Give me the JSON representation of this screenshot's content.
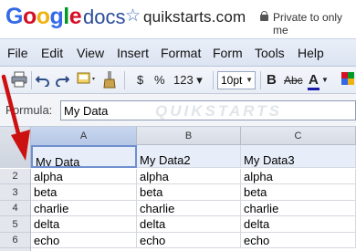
{
  "header": {
    "logo_letters": [
      {
        "ch": "G",
        "color": "#3369e8"
      },
      {
        "ch": "o",
        "color": "#d50f25"
      },
      {
        "ch": "o",
        "color": "#eeb211"
      },
      {
        "ch": "g",
        "color": "#3369e8"
      },
      {
        "ch": "l",
        "color": "#009925"
      },
      {
        "ch": "e",
        "color": "#d50f25"
      }
    ],
    "product": "docs",
    "star_icon": "star-icon",
    "doc_title": "quikstarts.com",
    "privacy": "Private to only me"
  },
  "menu": {
    "file": "File",
    "edit": "Edit",
    "view": "View",
    "insert": "Insert",
    "format": "Format",
    "form": "Form",
    "tools": "Tools",
    "help": "Help"
  },
  "toolbar": {
    "currency": "$",
    "percent": "%",
    "number_format": "123 ▾",
    "font_size": "10pt",
    "bold": "B",
    "strike": "Abc",
    "text_color": "A",
    "text_color_bar": "#1a1aa8"
  },
  "formula": {
    "label": "Formula:",
    "value": "My Data"
  },
  "watermark": "QUIKSTARTS",
  "grid": {
    "columns": [
      "A",
      "B",
      "C"
    ],
    "header_row": [
      "My Data",
      "My Data2",
      "My Data3"
    ],
    "rows": [
      {
        "num": "2",
        "cells": [
          "alpha",
          "alpha",
          "alpha"
        ]
      },
      {
        "num": "3",
        "cells": [
          "beta",
          "beta",
          "beta"
        ]
      },
      {
        "num": "4",
        "cells": [
          "charlie",
          "charlie",
          "charlie"
        ]
      },
      {
        "num": "5",
        "cells": [
          "delta",
          "delta",
          "delta"
        ]
      },
      {
        "num": "6",
        "cells": [
          "echo",
          "echo",
          "echo"
        ]
      }
    ]
  },
  "annotation": {
    "arrow_color": "#cc1111"
  }
}
